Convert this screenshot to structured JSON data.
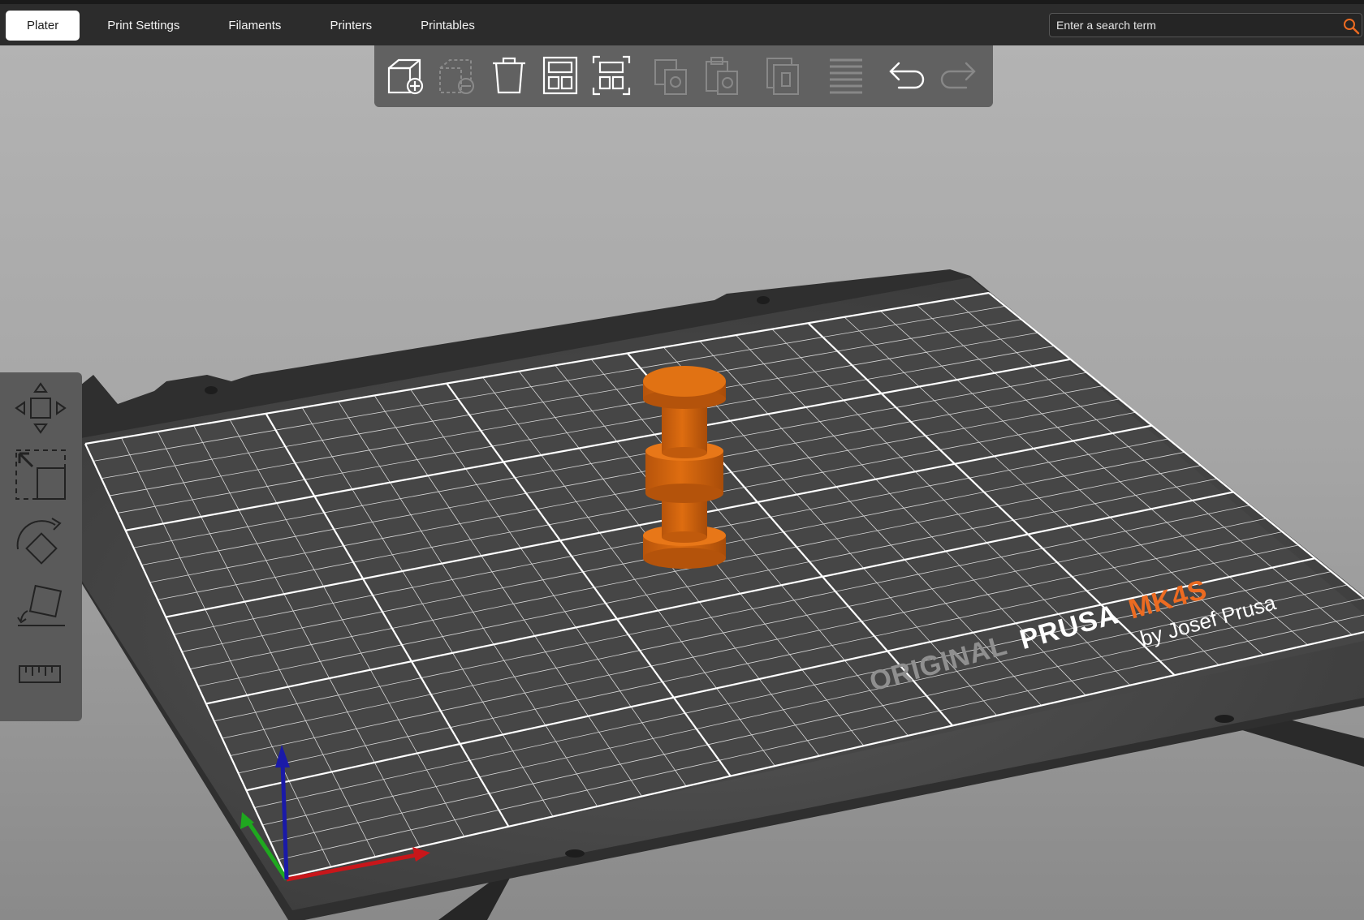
{
  "tabs": [
    {
      "label": "Plater",
      "active": true
    },
    {
      "label": "Print Settings",
      "active": false
    },
    {
      "label": "Filaments",
      "active": false
    },
    {
      "label": "Printers",
      "active": false
    },
    {
      "label": "Printables",
      "active": false
    }
  ],
  "search": {
    "placeholder": "Enter a search term",
    "icon": "search-icon"
  },
  "toolbar": {
    "items": [
      "add-object-icon",
      "delete-object-icon",
      "delete-all-icon",
      "arrange-icon",
      "arrange-selection-icon",
      "copy-icon",
      "paste-icon",
      "add-instance-icon",
      "layers-icon",
      "undo-icon",
      "redo-icon"
    ]
  },
  "left_tools": {
    "items": [
      "move-icon",
      "scale-icon",
      "rotate-icon",
      "place-on-face-icon",
      "measure-icon"
    ]
  },
  "bed": {
    "brand_line1_a": "ORIGINAL",
    "brand_line1_b": "PRUSA",
    "brand_line1_c": "MK4S",
    "brand_line2": "by Josef Prusa"
  },
  "colors": {
    "accent": "#ed6b21",
    "object": "#d9680f",
    "tab_bar": "#2c2c2c",
    "toolbar": "#616161",
    "bed": "#3a3a3a",
    "axis_x": "#c8161a",
    "axis_y": "#1fa81f",
    "axis_z": "#1a1aa8"
  }
}
